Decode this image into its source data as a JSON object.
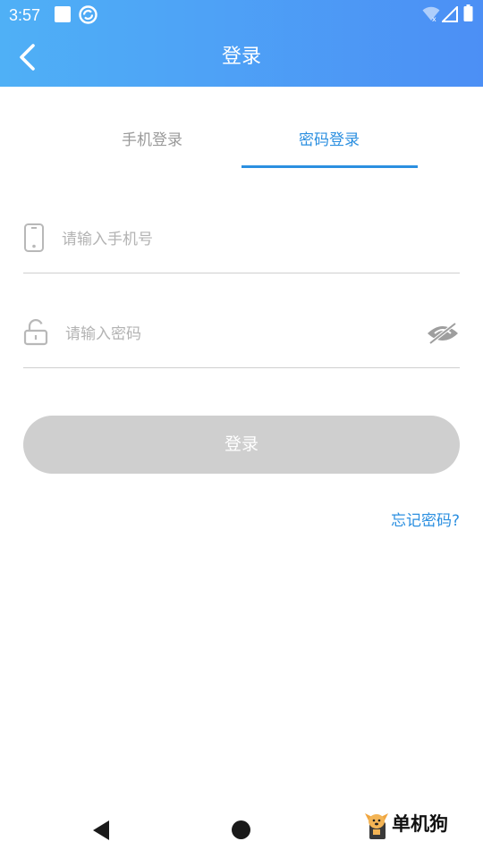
{
  "status_bar": {
    "time": "3:57",
    "left_icons": [
      "notification-square-icon",
      "sync-app-icon"
    ],
    "right_icons": [
      "wifi-icon",
      "signal-icon",
      "battery-icon"
    ]
  },
  "app_bar": {
    "back_icon": "chevron-left-icon",
    "title": "登录"
  },
  "tabs": [
    {
      "label": "手机登录",
      "active": false
    },
    {
      "label": "密码登录",
      "active": true
    }
  ],
  "form": {
    "phone": {
      "icon": "phone-icon",
      "placeholder": "请输入手机号",
      "value": ""
    },
    "password": {
      "icon": "lock-icon",
      "placeholder": "请输入密码",
      "value": "",
      "toggle_icon": "eye-off-icon"
    },
    "submit_label": "登录",
    "forgot_label": "忘记密码?"
  },
  "navigation": {
    "back_icon": "nav-back-triangle-icon",
    "home_icon": "nav-home-circle-icon"
  },
  "watermark": {
    "text": "单机狗",
    "logo_icon": "dog-logo-icon"
  },
  "colors": {
    "header_gradient_start": "#4fb0f6",
    "header_gradient_end": "#4c8ff5",
    "accent": "#2b8fe0",
    "inactive_tab": "#9a9a9a",
    "button_disabled": "#cfcfcf",
    "divider": "#cfcfcf"
  }
}
